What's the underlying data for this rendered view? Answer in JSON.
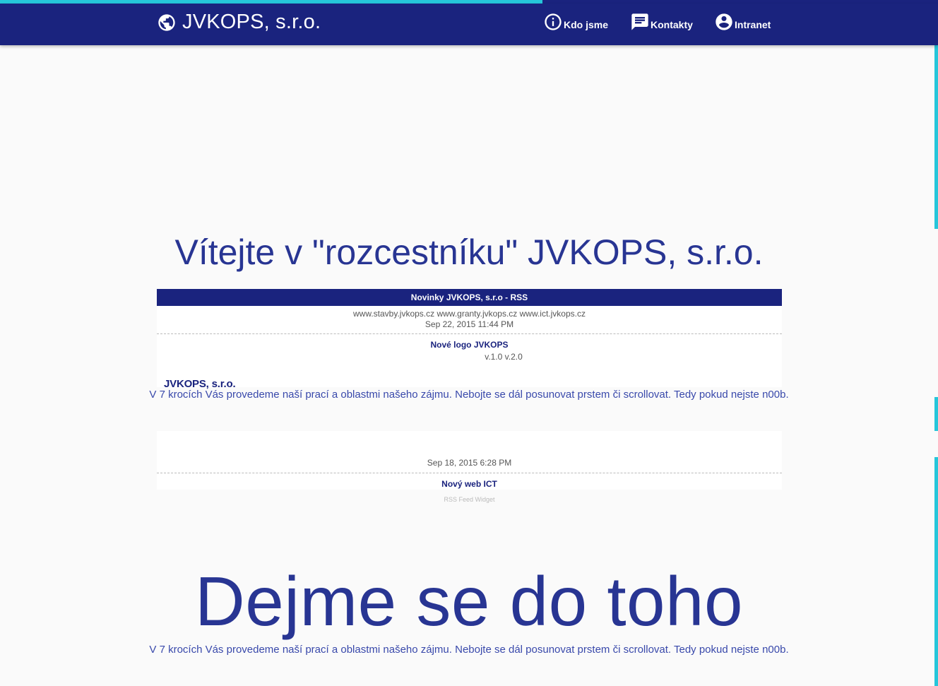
{
  "brand": {
    "title": "JVKOPS, s.r.o.",
    "icon": "globe-icon"
  },
  "nav": [
    {
      "label": "Kdo jsme",
      "icon": "info-icon"
    },
    {
      "label": "Kontakty",
      "icon": "chat-icon"
    },
    {
      "label": "Intranet",
      "icon": "account-circle-icon"
    }
  ],
  "scroll_progress": 0.578,
  "hero": {
    "title": "Vítejte v \"rozcestníku\" JVKOPS, s.r.o."
  },
  "rss": {
    "header": "Novinky JVKOPS, s.r.o - RSS",
    "items": [
      {
        "description": "www.stavby.jvkops.cz www.granty.jvkops.cz www.ict.jvkops.cz",
        "date": "Sep 22, 2015 11:44 PM"
      },
      {
        "title": "Nové logo JVKOPS",
        "description": "v.1.0 v.2.0",
        "logo_text": "JVKOPS, s.r.o."
      },
      {
        "date": "Sep 18, 2015 6:28 PM"
      },
      {
        "title": "Nový web ICT"
      }
    ],
    "footer": "RSS Feed Widget"
  },
  "section": {
    "title": "Dejme se do toho",
    "text": "V 7 krocích Vás provedeme naší prací a oblastmi našeho zájmu. Nebojte se dál posunovat prstem či scrollovat. Tedy pokud nejste n00b."
  },
  "colors": {
    "primary": "#1a237e",
    "accent": "#26c6da",
    "heading": "#283593",
    "background": "#fafafa"
  }
}
